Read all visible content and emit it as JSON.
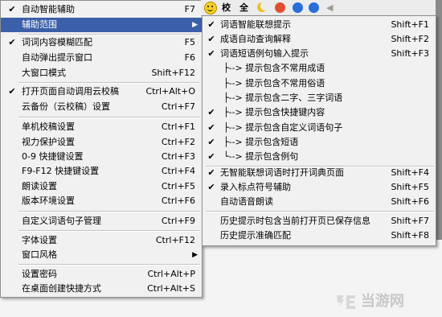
{
  "toolbar": {
    "btn1": "校",
    "btn2": "全"
  },
  "main_menu": {
    "items": [
      {
        "label": "自动智能辅助",
        "shortcut": "F7",
        "checked": true
      },
      {
        "label": "辅助范围",
        "submenu": true,
        "selected": true
      },
      {
        "label": "词词内容模糊匹配",
        "shortcut": "F5",
        "checked": true
      },
      {
        "label": "自动弹出提示窗口",
        "shortcut": "F6"
      },
      {
        "label": "大窗口模式",
        "shortcut": "Shift+F12"
      },
      {
        "label": "打开页面自动调用云校稿",
        "shortcut": "Ctrl+Alt+O",
        "checked": true
      },
      {
        "label": "云备份（云校稿）设置",
        "shortcut": "Ctrl+F7"
      },
      {
        "label": "单机校稿设置",
        "shortcut": "Ctrl+F1"
      },
      {
        "label": "视力保护设置",
        "shortcut": "Ctrl+F2"
      },
      {
        "label": "0-9 快捷键设置",
        "shortcut": "Ctrl+F3"
      },
      {
        "label": "F9-F12 快捷键设置",
        "shortcut": "Ctrl+F4"
      },
      {
        "label": "朗读设置",
        "shortcut": "Ctrl+F5"
      },
      {
        "label": "版本环境设置",
        "shortcut": "Ctrl+F6"
      },
      {
        "label": "自定义词语句子管理",
        "shortcut": "Ctrl+F9"
      },
      {
        "label": "字体设置",
        "shortcut": "Ctrl+F12"
      },
      {
        "label": "窗口风格",
        "submenu": true
      },
      {
        "label": "设置密码",
        "shortcut": "Ctrl+Alt+P"
      },
      {
        "label": "在桌面创建快捷方式",
        "shortcut": "Ctrl+Alt+S"
      }
    ]
  },
  "sub_menu": {
    "items": [
      {
        "label": "词语智能联想提示",
        "shortcut": "Shift+F1",
        "checked": true
      },
      {
        "label": "成语自动查询解释",
        "shortcut": "Shift+F2",
        "checked": true
      },
      {
        "label": "词语短语例句输入提示",
        "shortcut": "Shift+F3",
        "checked": true
      },
      {
        "label": "├--> 提示包含不常用成语"
      },
      {
        "label": "├--> 提示包含不常用俗语"
      },
      {
        "label": "├--> 提示包含二字、三字词语"
      },
      {
        "label": "├--> 提示包含快捷键内容",
        "checked": true
      },
      {
        "label": "├--> 提示包含自定义词语句子",
        "checked": true
      },
      {
        "label": "├--> 提示包含短语",
        "checked": true
      },
      {
        "label": "└--> 提示包含例句",
        "checked": true
      },
      {
        "label": "无智能联想词语时打开词典页面",
        "shortcut": "Shift+F4",
        "checked": true
      },
      {
        "label": "录入标点符号辅助",
        "shortcut": "Shift+F5",
        "checked": true
      },
      {
        "label": "自动语音朗读",
        "shortcut": "Shift+F6"
      },
      {
        "label": "历史提示时包含当前打开页已保存信息",
        "shortcut": "Shift+F7"
      },
      {
        "label": "历史提示准确匹配",
        "shortcut": "Shift+F8"
      }
    ]
  },
  "glyphs": {
    "check": "✔",
    "arrow": "▶"
  },
  "watermark": {
    "text": "当游网"
  },
  "colors": {
    "selection": "#3b5fa8",
    "menu_bg": "#f1f1f1"
  }
}
